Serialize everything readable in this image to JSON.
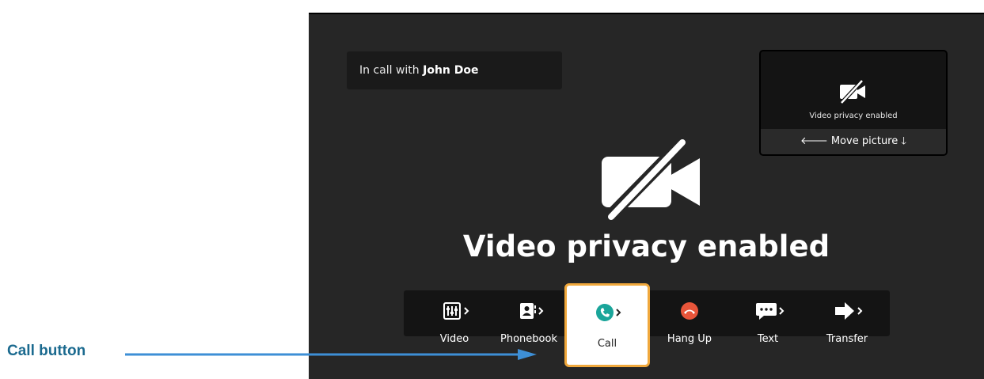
{
  "call_status": {
    "prefix": "In call with ",
    "name": "John Doe"
  },
  "pip": {
    "icon": "video-off-icon",
    "text": "Video privacy enabled",
    "move_label": "Move picture"
  },
  "main": {
    "icon": "video-off-icon",
    "message": "Video privacy enabled"
  },
  "toolbar": {
    "video_label": "Video",
    "phonebook_label": "Phonebook",
    "call_label": "Call",
    "hangup_label": "Hang Up",
    "text_label": "Text",
    "transfer_label": "Transfer"
  },
  "annotation": {
    "label": "Call button"
  },
  "colors": {
    "accent_border": "#f0a83c",
    "call_icon": "#1aa59a",
    "hangup_icon": "#e8553a",
    "annotation": "#1b6a8f",
    "arrow": "#3d8fd6"
  }
}
